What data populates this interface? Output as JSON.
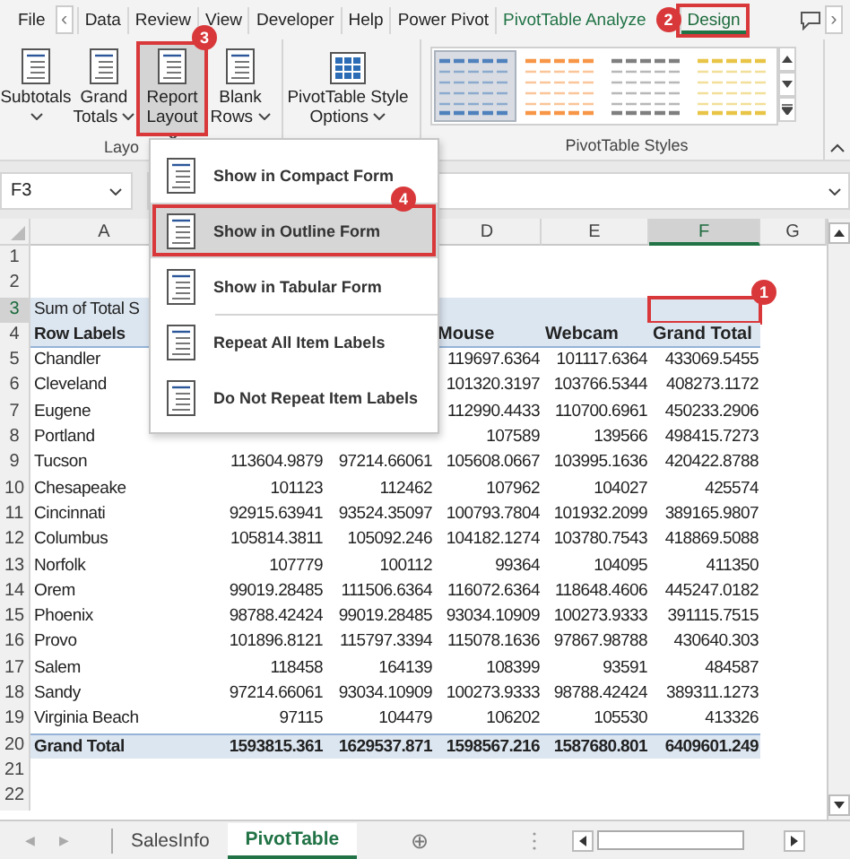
{
  "ribbon_tabs": {
    "scroll_left": "‹",
    "scroll_right": "›",
    "tabs": [
      {
        "label": "File",
        "selected": false,
        "contextual": false
      },
      {
        "label": "Data",
        "selected": false,
        "contextual": false
      },
      {
        "label": "Review",
        "selected": false,
        "contextual": false
      },
      {
        "label": "View",
        "selected": false,
        "contextual": false
      },
      {
        "label": "Developer",
        "selected": false,
        "contextual": false
      },
      {
        "label": "Help",
        "selected": false,
        "contextual": false
      },
      {
        "label": "Power Pivot",
        "selected": false,
        "contextual": false
      },
      {
        "label": "PivotTable Analyze",
        "selected": false,
        "contextual": true
      },
      {
        "label": "Design",
        "selected": true,
        "contextual": true,
        "callout": "2"
      }
    ]
  },
  "ribbon": {
    "layout_group": {
      "label": "Layo",
      "buttons": [
        {
          "label": "Subtotals",
          "pressed": false
        },
        {
          "label": "Grand Totals",
          "pressed": false
        },
        {
          "label": "Report Layout",
          "pressed": true,
          "callout": "3"
        },
        {
          "label": "Blank Rows",
          "pressed": false
        }
      ]
    },
    "style_options_button": "PivotTable Style Options",
    "styles_group": {
      "label": "PivotTable Styles",
      "styles": [
        {
          "color": "#4f81bd",
          "selected": true
        },
        {
          "color": "#f79646",
          "selected": false
        },
        {
          "color": "#7f7f7f",
          "selected": false
        },
        {
          "color": "#e8c547",
          "selected": false
        }
      ]
    }
  },
  "formula_bar": {
    "name_box": "F3"
  },
  "menu": {
    "items": [
      {
        "label": "Show in Compact Form",
        "selected": false,
        "separator_before": false
      },
      {
        "label": "Show in Outline Form",
        "selected": true,
        "separator_before": false,
        "callout": "4"
      },
      {
        "label": "Show in Tabular Form",
        "selected": false,
        "separator_before": false
      },
      {
        "label": "Repeat All Item Labels",
        "selected": false,
        "separator_before": true
      },
      {
        "label": "Do Not Repeat Item Labels",
        "selected": false,
        "separator_before": false
      }
    ]
  },
  "sheet": {
    "columns": [
      {
        "label": "A",
        "selected": false,
        "kind": "visible"
      },
      {
        "kind": "covered"
      },
      {
        "kind": "covered"
      },
      {
        "label": "D",
        "selected": false,
        "kind": "visible"
      },
      {
        "label": "E",
        "selected": false,
        "kind": "visible"
      },
      {
        "label": "F",
        "selected": true,
        "kind": "visible"
      },
      {
        "label": "G",
        "selected": false,
        "kind": "visible"
      }
    ],
    "rows": [
      {
        "num": "1",
        "selected": false,
        "kind": "blank",
        "cells": []
      },
      {
        "num": "2",
        "selected": false,
        "kind": "blank",
        "cells": []
      },
      {
        "num": "3",
        "selected": true,
        "kind": "title",
        "cells": [
          "Sum of Total S",
          null,
          null,
          null,
          null,
          {
            "active": true,
            "callout": "1"
          }
        ]
      },
      {
        "num": "4",
        "selected": false,
        "kind": "header",
        "cells": [
          "Row Labels",
          null,
          null,
          "Mouse",
          "Webcam",
          "Grand Total"
        ]
      },
      {
        "num": "5",
        "selected": false,
        "kind": "data",
        "cells": [
          "Chandler",
          null,
          null,
          "119697.6364",
          "101117.6364",
          "433069.5455"
        ]
      },
      {
        "num": "6",
        "selected": false,
        "kind": "data",
        "cells": [
          "Cleveland",
          null,
          null,
          "101320.3197",
          "103766.5344",
          "408273.1172"
        ]
      },
      {
        "num": "7",
        "selected": false,
        "kind": "data",
        "cells": [
          "Eugene",
          null,
          null,
          "112990.4433",
          "110700.6961",
          "450233.2906"
        ]
      },
      {
        "num": "8",
        "selected": false,
        "kind": "data",
        "cells": [
          "Portland",
          null,
          null,
          "107589",
          "139566",
          "498415.7273"
        ]
      },
      {
        "num": "9",
        "selected": false,
        "kind": "data",
        "cells": [
          "Tucson",
          "113604.9879",
          "97214.66061",
          "105608.0667",
          "103995.1636",
          "420422.8788"
        ]
      },
      {
        "num": "10",
        "selected": false,
        "kind": "data",
        "cells": [
          "Chesapeake",
          "101123",
          "112462",
          "107962",
          "104027",
          "425574"
        ]
      },
      {
        "num": "11",
        "selected": false,
        "kind": "data",
        "cells": [
          "Cincinnati",
          "92915.63941",
          "93524.35097",
          "100793.7804",
          "101932.2099",
          "389165.9807"
        ]
      },
      {
        "num": "12",
        "selected": false,
        "kind": "data",
        "cells": [
          "Columbus",
          "105814.3811",
          "105092.246",
          "104182.1274",
          "103780.7543",
          "418869.5088"
        ]
      },
      {
        "num": "13",
        "selected": false,
        "kind": "data",
        "cells": [
          "Norfolk",
          "107779",
          "100112",
          "99364",
          "104095",
          "411350"
        ]
      },
      {
        "num": "14",
        "selected": false,
        "kind": "data",
        "cells": [
          "Orem",
          "99019.28485",
          "111506.6364",
          "116072.6364",
          "118648.4606",
          "445247.0182"
        ]
      },
      {
        "num": "15",
        "selected": false,
        "kind": "data",
        "cells": [
          "Phoenix",
          "98788.42424",
          "99019.28485",
          "93034.10909",
          "100273.9333",
          "391115.7515"
        ]
      },
      {
        "num": "16",
        "selected": false,
        "kind": "data",
        "cells": [
          "Provo",
          "101896.8121",
          "115797.3394",
          "115078.1636",
          "97867.98788",
          "430640.303"
        ]
      },
      {
        "num": "17",
        "selected": false,
        "kind": "data",
        "cells": [
          "Salem",
          "118458",
          "164139",
          "108399",
          "93591",
          "484587"
        ]
      },
      {
        "num": "18",
        "selected": false,
        "kind": "data",
        "cells": [
          "Sandy",
          "97214.66061",
          "93034.10909",
          "100273.9333",
          "98788.42424",
          "389311.1273"
        ]
      },
      {
        "num": "19",
        "selected": false,
        "kind": "data",
        "cells": [
          "Virginia Beach",
          "97115",
          "104479",
          "106202",
          "105530",
          "413326"
        ]
      },
      {
        "num": "20",
        "selected": false,
        "kind": "total",
        "cells": [
          "Grand Total",
          "1593815.361",
          "1629537.871",
          "1598567.216",
          "1587680.801",
          "6409601.249"
        ]
      },
      {
        "num": "21",
        "selected": false,
        "kind": "blank",
        "cells": []
      },
      {
        "num": "22",
        "selected": false,
        "kind": "blank",
        "cells": []
      }
    ]
  },
  "sheet_tabs": {
    "nav_left": "◀",
    "nav_right": "▶",
    "add": "⊕",
    "tabs": [
      {
        "label": "SalesInfo",
        "selected": false
      },
      {
        "label": "PivotTable",
        "selected": true
      }
    ]
  }
}
